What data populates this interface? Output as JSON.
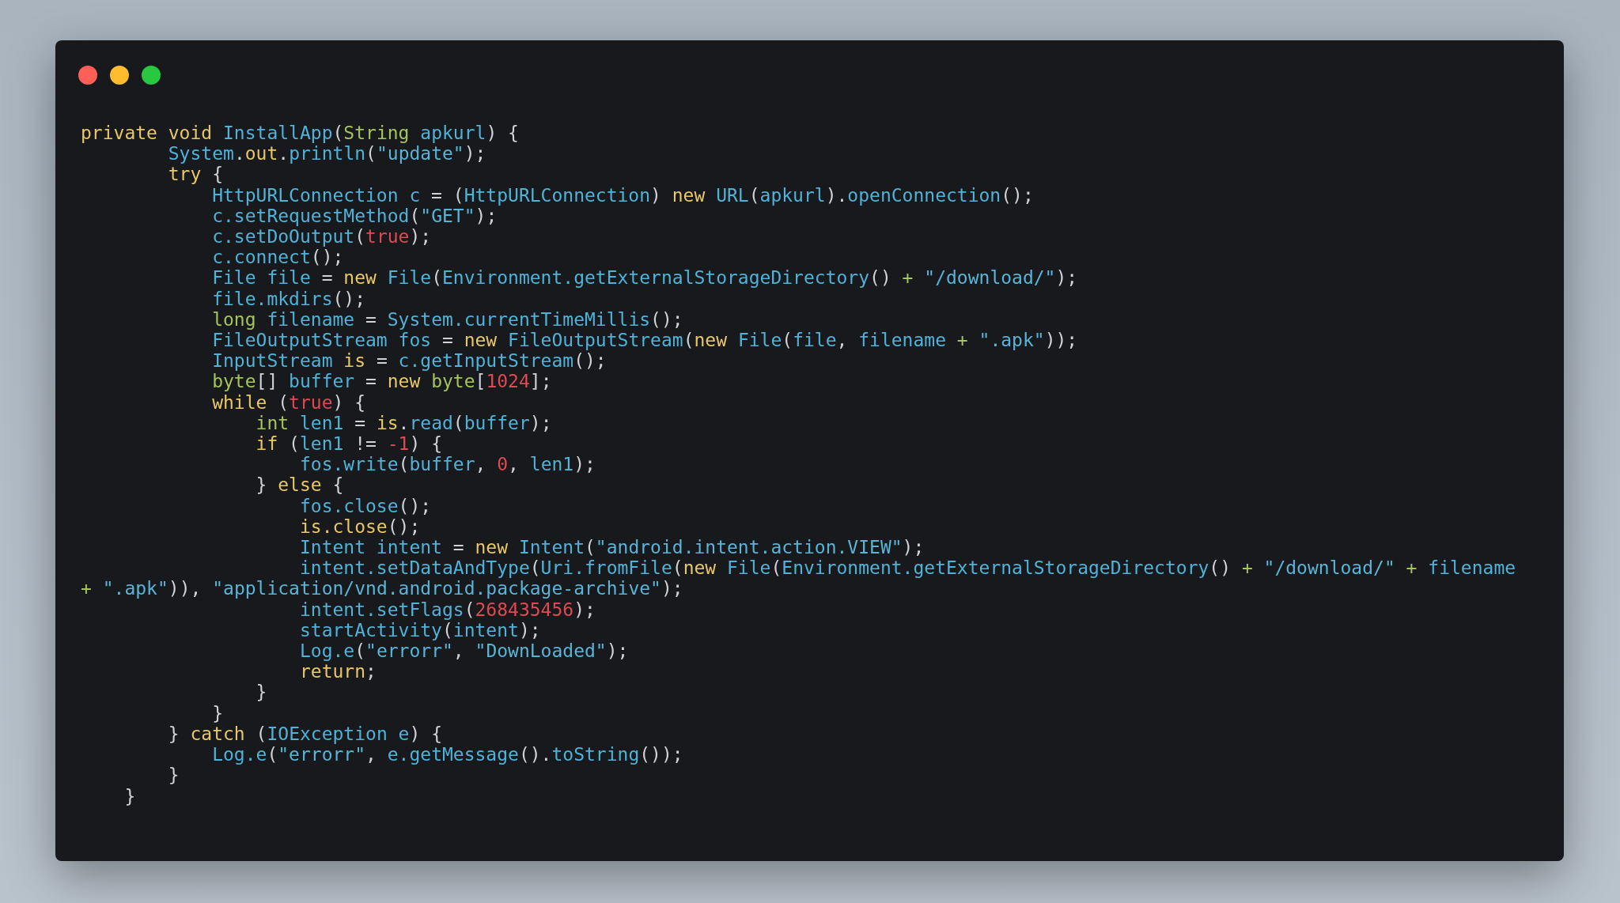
{
  "code": {
    "lines": [
      [
        {
          "text": "private void ",
          "kind": "keyword"
        },
        {
          "text": "InstallApp",
          "kind": "ident"
        },
        {
          "text": "(",
          "kind": "punct"
        },
        {
          "text": "String",
          "kind": "type"
        },
        {
          "text": " apkurl",
          "kind": "ident"
        },
        {
          "text": ") {",
          "kind": "punct"
        }
      ],
      [
        {
          "text": "        System",
          "kind": "ident"
        },
        {
          "text": ".",
          "kind": "punct"
        },
        {
          "text": "out",
          "kind": "keyword"
        },
        {
          "text": ".",
          "kind": "punct"
        },
        {
          "text": "println",
          "kind": "ident"
        },
        {
          "text": "(",
          "kind": "punct"
        },
        {
          "text": "\"update\"",
          "kind": "string"
        },
        {
          "text": ");",
          "kind": "punct"
        }
      ],
      [
        {
          "text": "        try",
          "kind": "keyword"
        },
        {
          "text": " {",
          "kind": "punct"
        }
      ],
      [
        {
          "text": "            HttpURLConnection c ",
          "kind": "ident"
        },
        {
          "text": "= (",
          "kind": "punct"
        },
        {
          "text": "HttpURLConnection",
          "kind": "ident"
        },
        {
          "text": ") ",
          "kind": "punct"
        },
        {
          "text": "new",
          "kind": "keyword"
        },
        {
          "text": " URL",
          "kind": "ident"
        },
        {
          "text": "(",
          "kind": "punct"
        },
        {
          "text": "apkurl",
          "kind": "ident"
        },
        {
          "text": ").",
          "kind": "punct"
        },
        {
          "text": "openConnection",
          "kind": "ident"
        },
        {
          "text": "();",
          "kind": "punct"
        }
      ],
      [
        {
          "text": "            c.setRequestMethod",
          "kind": "ident"
        },
        {
          "text": "(",
          "kind": "punct"
        },
        {
          "text": "\"GET\"",
          "kind": "string"
        },
        {
          "text": ");",
          "kind": "punct"
        }
      ],
      [
        {
          "text": "            c.setDoOutput",
          "kind": "ident"
        },
        {
          "text": "(",
          "kind": "punct"
        },
        {
          "text": "true",
          "kind": "number"
        },
        {
          "text": ");",
          "kind": "punct"
        }
      ],
      [
        {
          "text": "            c.connect",
          "kind": "ident"
        },
        {
          "text": "();",
          "kind": "punct"
        }
      ],
      [
        {
          "text": "            File file ",
          "kind": "ident"
        },
        {
          "text": "= ",
          "kind": "punct"
        },
        {
          "text": "new",
          "kind": "keyword"
        },
        {
          "text": " File",
          "kind": "ident"
        },
        {
          "text": "(",
          "kind": "punct"
        },
        {
          "text": "Environment.getExternalStorageDirectory",
          "kind": "ident"
        },
        {
          "text": "() ",
          "kind": "punct"
        },
        {
          "text": "+",
          "kind": "type"
        },
        {
          "text": " \"/download/\"",
          "kind": "string"
        },
        {
          "text": ");",
          "kind": "punct"
        }
      ],
      [
        {
          "text": "            file.mkdirs",
          "kind": "ident"
        },
        {
          "text": "();",
          "kind": "punct"
        }
      ],
      [
        {
          "text": "            long",
          "kind": "type"
        },
        {
          "text": " filename ",
          "kind": "ident"
        },
        {
          "text": "= ",
          "kind": "punct"
        },
        {
          "text": "System.currentTimeMillis",
          "kind": "ident"
        },
        {
          "text": "();",
          "kind": "punct"
        }
      ],
      [
        {
          "text": "            FileOutputStream fos ",
          "kind": "ident"
        },
        {
          "text": "= ",
          "kind": "punct"
        },
        {
          "text": "new",
          "kind": "keyword"
        },
        {
          "text": " FileOutputStream",
          "kind": "ident"
        },
        {
          "text": "(",
          "kind": "punct"
        },
        {
          "text": "new",
          "kind": "keyword"
        },
        {
          "text": " File",
          "kind": "ident"
        },
        {
          "text": "(",
          "kind": "punct"
        },
        {
          "text": "file",
          "kind": "ident"
        },
        {
          "text": ", ",
          "kind": "punct"
        },
        {
          "text": "filename ",
          "kind": "ident"
        },
        {
          "text": "+",
          "kind": "type"
        },
        {
          "text": " \".apk\"",
          "kind": "string"
        },
        {
          "text": "));",
          "kind": "punct"
        }
      ],
      [
        {
          "text": "            InputStream ",
          "kind": "ident"
        },
        {
          "text": "is",
          "kind": "keyword"
        },
        {
          "text": " = ",
          "kind": "punct"
        },
        {
          "text": "c.getInputStream",
          "kind": "ident"
        },
        {
          "text": "();",
          "kind": "punct"
        }
      ],
      [
        {
          "text": "            byte",
          "kind": "type"
        },
        {
          "text": "[] ",
          "kind": "punct"
        },
        {
          "text": "buffer ",
          "kind": "ident"
        },
        {
          "text": "= ",
          "kind": "punct"
        },
        {
          "text": "new",
          "kind": "keyword"
        },
        {
          "text": " byte",
          "kind": "type"
        },
        {
          "text": "[",
          "kind": "punct"
        },
        {
          "text": "1024",
          "kind": "number"
        },
        {
          "text": "];",
          "kind": "punct"
        }
      ],
      [
        {
          "text": "            while",
          "kind": "keyword"
        },
        {
          "text": " (",
          "kind": "punct"
        },
        {
          "text": "true",
          "kind": "number"
        },
        {
          "text": ") {",
          "kind": "punct"
        }
      ],
      [
        {
          "text": "                int",
          "kind": "type"
        },
        {
          "text": " len1 ",
          "kind": "ident"
        },
        {
          "text": "= ",
          "kind": "punct"
        },
        {
          "text": "is",
          "kind": "keyword"
        },
        {
          "text": ".",
          "kind": "punct"
        },
        {
          "text": "read",
          "kind": "ident"
        },
        {
          "text": "(",
          "kind": "punct"
        },
        {
          "text": "buffer",
          "kind": "ident"
        },
        {
          "text": ");",
          "kind": "punct"
        }
      ],
      [
        {
          "text": "                if",
          "kind": "keyword"
        },
        {
          "text": " (",
          "kind": "punct"
        },
        {
          "text": "len1 ",
          "kind": "ident"
        },
        {
          "text": "!= ",
          "kind": "punct"
        },
        {
          "text": "-1",
          "kind": "number"
        },
        {
          "text": ") {",
          "kind": "punct"
        }
      ],
      [
        {
          "text": "                    fos.write",
          "kind": "ident"
        },
        {
          "text": "(",
          "kind": "punct"
        },
        {
          "text": "buffer",
          "kind": "ident"
        },
        {
          "text": ", ",
          "kind": "punct"
        },
        {
          "text": "0",
          "kind": "number"
        },
        {
          "text": ", ",
          "kind": "punct"
        },
        {
          "text": "len1",
          "kind": "ident"
        },
        {
          "text": ");",
          "kind": "punct"
        }
      ],
      [
        {
          "text": "                } ",
          "kind": "punct"
        },
        {
          "text": "else",
          "kind": "keyword"
        },
        {
          "text": " {",
          "kind": "punct"
        }
      ],
      [
        {
          "text": "                    fos.close",
          "kind": "ident"
        },
        {
          "text": "();",
          "kind": "punct"
        }
      ],
      [
        {
          "text": "                    is.close",
          "kind": "keyword"
        },
        {
          "text": "();",
          "kind": "punct"
        }
      ],
      [
        {
          "text": "                    Intent intent ",
          "kind": "ident"
        },
        {
          "text": "= ",
          "kind": "punct"
        },
        {
          "text": "new",
          "kind": "keyword"
        },
        {
          "text": " Intent",
          "kind": "ident"
        },
        {
          "text": "(",
          "kind": "punct"
        },
        {
          "text": "\"android.intent.action.VIEW\"",
          "kind": "string"
        },
        {
          "text": ");",
          "kind": "punct"
        }
      ],
      [
        {
          "text": "                    intent.setDataAndType",
          "kind": "ident"
        },
        {
          "text": "(",
          "kind": "punct"
        },
        {
          "text": "Uri.fromFile",
          "kind": "ident"
        },
        {
          "text": "(",
          "kind": "punct"
        },
        {
          "text": "new",
          "kind": "keyword"
        },
        {
          "text": " File",
          "kind": "ident"
        },
        {
          "text": "(",
          "kind": "punct"
        },
        {
          "text": "Environment.getExternalStorageDirectory",
          "kind": "ident"
        },
        {
          "text": "() ",
          "kind": "punct"
        },
        {
          "text": "+",
          "kind": "type"
        },
        {
          "text": " \"/download/\" ",
          "kind": "string"
        },
        {
          "text": "+",
          "kind": "type"
        },
        {
          "text": " filename",
          "kind": "ident"
        }
      ],
      [
        {
          "text": "+",
          "kind": "type"
        },
        {
          "text": " \".apk\"",
          "kind": "string"
        },
        {
          "text": ")), ",
          "kind": "punct"
        },
        {
          "text": "\"application/vnd.android.package-archive\"",
          "kind": "string"
        },
        {
          "text": ");",
          "kind": "punct"
        }
      ],
      [
        {
          "text": "                    intent.setFlags",
          "kind": "ident"
        },
        {
          "text": "(",
          "kind": "punct"
        },
        {
          "text": "268435456",
          "kind": "number"
        },
        {
          "text": ");",
          "kind": "punct"
        }
      ],
      [
        {
          "text": "                    startActivity",
          "kind": "ident"
        },
        {
          "text": "(",
          "kind": "punct"
        },
        {
          "text": "intent",
          "kind": "ident"
        },
        {
          "text": ");",
          "kind": "punct"
        }
      ],
      [
        {
          "text": "                    Log.e",
          "kind": "ident"
        },
        {
          "text": "(",
          "kind": "punct"
        },
        {
          "text": "\"errorr\"",
          "kind": "string"
        },
        {
          "text": ", ",
          "kind": "punct"
        },
        {
          "text": "\"DownLoaded\"",
          "kind": "string"
        },
        {
          "text": ");",
          "kind": "punct"
        }
      ],
      [
        {
          "text": "                    return",
          "kind": "keyword"
        },
        {
          "text": ";",
          "kind": "punct"
        }
      ],
      [
        {
          "text": "                }",
          "kind": "punct"
        }
      ],
      [
        {
          "text": "            }",
          "kind": "punct"
        }
      ],
      [
        {
          "text": "        } ",
          "kind": "punct"
        },
        {
          "text": "catch",
          "kind": "keyword"
        },
        {
          "text": " (",
          "kind": "punct"
        },
        {
          "text": "IOException e",
          "kind": "ident"
        },
        {
          "text": ") {",
          "kind": "punct"
        }
      ],
      [
        {
          "text": "            Log.e",
          "kind": "ident"
        },
        {
          "text": "(",
          "kind": "punct"
        },
        {
          "text": "\"errorr\"",
          "kind": "string"
        },
        {
          "text": ", ",
          "kind": "punct"
        },
        {
          "text": "e.getMessage",
          "kind": "ident"
        },
        {
          "text": "().",
          "kind": "punct"
        },
        {
          "text": "toString",
          "kind": "ident"
        },
        {
          "text": "());",
          "kind": "punct"
        }
      ],
      [
        {
          "text": "        }",
          "kind": "punct"
        }
      ],
      [
        {
          "text": "    }",
          "kind": "punct"
        }
      ]
    ]
  }
}
